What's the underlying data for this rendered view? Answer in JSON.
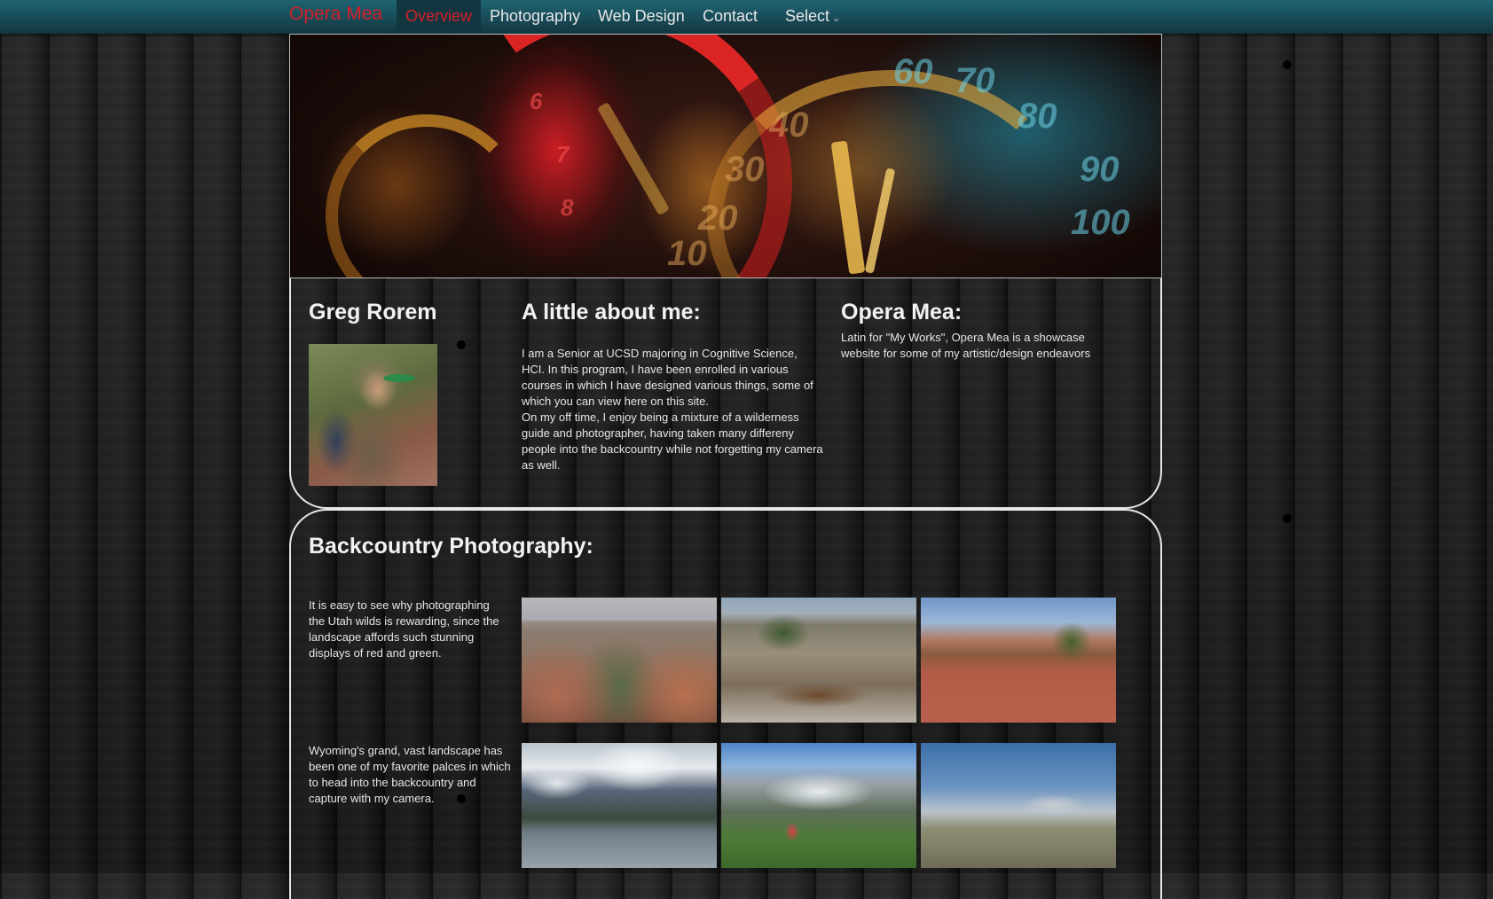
{
  "navbar": {
    "brand": "Opera Mea",
    "items": [
      "Overview",
      "Photography",
      "Web Design",
      "Contact"
    ],
    "active_item": "Overview",
    "select_label": "Select",
    "colors": {
      "brand": "#d41f29",
      "bar": "#1f6472"
    }
  },
  "about": {
    "name": "Greg Rorem",
    "about_heading": "A little about me:",
    "about_paragraphs": [
      "I am a Senior at UCSD majoring in Cognitive Science, HCI. In this program, I have been enrolled in various courses in which I have designed various things, some of which you can view here on this site.",
      "On my off time, I enjoy being a mixture of a wilderness guide and photographer, having taken many differeny people into the backcountry while not forgetting my camera as well."
    ],
    "site_heading": "Opera Mea:",
    "site_text": "Latin for \"My Works\", Opera Mea is a showcase website for some of my artistic/design endeavors"
  },
  "photography": {
    "heading": "Backcountry Photography:",
    "rows": [
      {
        "caption": "It is easy to see why photographing the Utah wilds is rewarding, since the landscape affords such stunning displays of red and green."
      },
      {
        "caption": "Wyoming's grand, vast landscape has been one of my favorite palces in which to head into the backcountry and capture with my camera."
      }
    ]
  }
}
